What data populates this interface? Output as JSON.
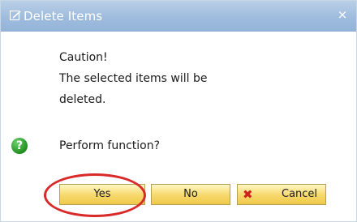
{
  "window": {
    "title": "Delete Items",
    "title_icon": "dialog-edit-icon",
    "close_glyph": "×"
  },
  "message": {
    "line1": "Caution!",
    "line2": "The selected items will be",
    "line3": "deleted."
  },
  "prompt": {
    "icon": "question-icon",
    "icon_glyph": "?",
    "text": "Perform function?"
  },
  "buttons": {
    "yes": "Yes",
    "no": "No",
    "cancel": "Cancel",
    "cancel_icon_glyph": "✖"
  },
  "colors": {
    "titlebar": "#9fbcdd",
    "button_fill": "#f6d86a",
    "highlight_ring": "#d92a2a",
    "cancel_icon": "#d02020",
    "question_icon": "#1f8f1f"
  }
}
